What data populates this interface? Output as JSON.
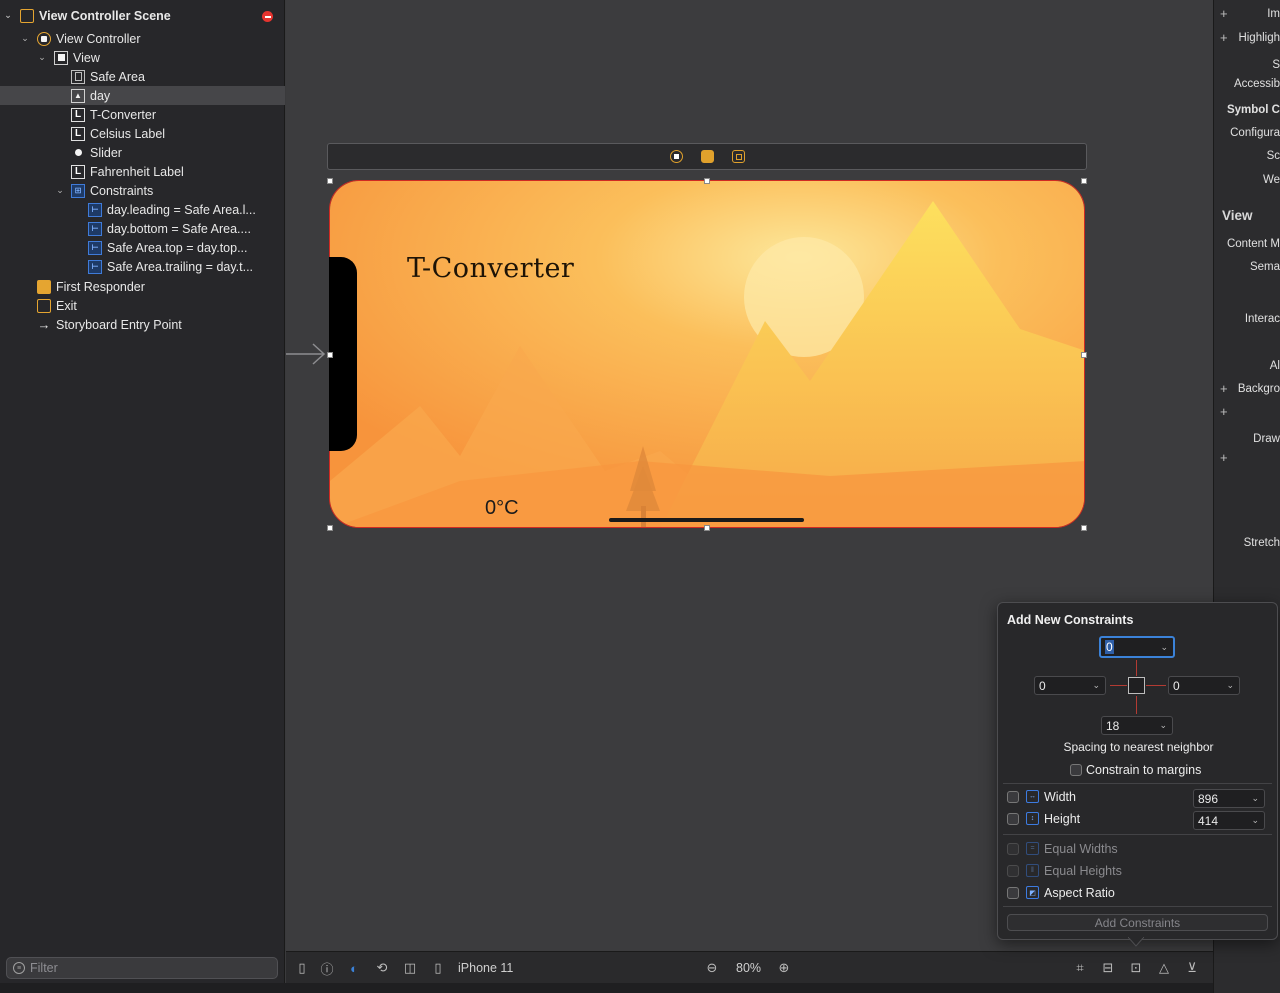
{
  "outline": {
    "scene_title": "View Controller Scene",
    "items": [
      {
        "label": "View Controller Scene"
      },
      {
        "label": "View Controller"
      },
      {
        "label": "View"
      },
      {
        "label": "Safe Area"
      },
      {
        "label": "day"
      },
      {
        "label": "T-Converter"
      },
      {
        "label": "Celsius Label"
      },
      {
        "label": "Slider"
      },
      {
        "label": "Fahrenheit Label"
      },
      {
        "label": "Constraints"
      },
      {
        "label": "day.leading = Safe Area.l..."
      },
      {
        "label": "day.bottom = Safe Area...."
      },
      {
        "label": "Safe Area.top = day.top..."
      },
      {
        "label": "Safe Area.trailing = day.t..."
      },
      {
        "label": "First Responder"
      },
      {
        "label": "Exit"
      },
      {
        "label": "Storyboard Entry Point"
      }
    ],
    "filter_placeholder": "Filter"
  },
  "canvas": {
    "app_title": "T-Converter",
    "celsius_value": "0°C"
  },
  "toolbar": {
    "device": "iPhone 11",
    "zoom": "80%"
  },
  "inspector": {
    "rows": [
      "Im",
      "Highligh",
      "S",
      "Accessib",
      "Symbol C",
      "Configura",
      "Sc",
      "We",
      "View",
      "Content M",
      "Sema",
      "Interac",
      "Al",
      "Backgro",
      "Draw",
      "Stretch"
    ]
  },
  "popover": {
    "title": "Add New Constraints",
    "top": "0",
    "left": "0",
    "right": "0",
    "bottom": "18",
    "spacing_label": "Spacing to nearest neighbor",
    "constrain_margins": "Constrain to margins",
    "width_label": "Width",
    "width_value": "896",
    "height_label": "Height",
    "height_value": "414",
    "equal_widths": "Equal Widths",
    "equal_heights": "Equal Heights",
    "aspect_ratio": "Aspect Ratio",
    "add_button": "Add Constraints"
  },
  "colors": {
    "accent": "#3b82d8",
    "warning": "#e5342f",
    "scene_orange": "#f5a040"
  }
}
